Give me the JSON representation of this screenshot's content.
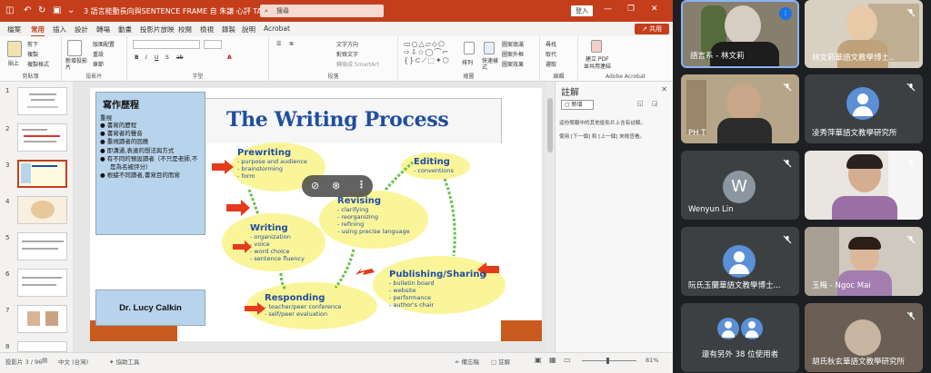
{
  "ppt": {
    "title": "3 語言能動長向與SENTENCE FRAME 自 朱謙 心評 TAWL  -  PowerPoint",
    "search_placeholder": "搜尋",
    "signin": "登入",
    "share": "共用",
    "tabs": [
      "檔案",
      "常用",
      "插入",
      "設計",
      "轉場",
      "動畫",
      "投影片放映",
      "校閱",
      "檢視",
      "錄製",
      "說明",
      "Acrobat"
    ],
    "active_tab": "常用",
    "ribbon": {
      "groups": [
        "剪貼簿",
        "投影片",
        "字型",
        "段落",
        "繪圖",
        "編輯",
        "Adobe Acrobat"
      ],
      "paste": "貼上",
      "cut": "剪下",
      "copy": "複製",
      "format_painter": "複製格式",
      "new_slide": "新增投影片",
      "layout": "版面配置",
      "reset": "重設",
      "section": "章節",
      "arrange": "排列",
      "quick_styles": "快速樣式",
      "shape_fill": "圖案填滿",
      "shape_outline": "圖案外框",
      "shape_effects": "圖案效果",
      "find": "尋找",
      "replace": "取代",
      "select": "選取",
      "create_pdf": "建立 PDF",
      "share_link": "並共用連結",
      "text_direction": "文字方向",
      "align_text": "對齊文字",
      "smartart": "轉換成 SmartArt"
    },
    "slide_numbers": [
      "1",
      "2",
      "3",
      "4",
      "5",
      "6",
      "7",
      "8"
    ],
    "slide": {
      "box_title": "寫作歷程",
      "box_subtitle": "重視",
      "bullets": [
        "書寫的歷程",
        "書寫者的聲音",
        "重視讀者的回應",
        "即溝通,表達的想法與方式",
        "有不同的預設讀者（不只是老師,不是為名被評分）",
        "根據不同讀者,書寫目的而寫"
      ],
      "author": "Dr. Lucy Calkin",
      "heading": "The Writing Process",
      "stages": {
        "prewriting": {
          "title": "Prewriting",
          "items": [
            "- purpose and audience",
            "- brainstorming",
            "- form"
          ]
        },
        "editing": {
          "title": "Editing",
          "items": [
            "- conventions"
          ]
        },
        "revising": {
          "title": "Revising",
          "items": [
            "- clarifying",
            "- reorganizing",
            "- refining",
            "- using precise language"
          ]
        },
        "writing": {
          "title": "Writing",
          "items": [
            "- organization",
            "- voice",
            "- word choice",
            "- sentence fluency"
          ]
        },
        "publishing": {
          "title": "Publishing/Sharing",
          "items": [
            "- bulletin board",
            "- website",
            "- performance",
            "- author's chair"
          ]
        },
        "responding": {
          "title": "Responding",
          "items": [
            "- teacher/peer conference",
            "- self/peer evaluation"
          ]
        }
      }
    },
    "comments": {
      "title": "註解",
      "new": "新增",
      "line1": "這份簡報中的其他投影片上含有註解。",
      "line2": "使用 [下一個] 和 [上一個] 來檢查看。"
    },
    "status": {
      "slide_of": "投影片 3 / 96",
      "lang": "中文 (台灣)",
      "access": "協助工具",
      "notes": "備忘稿",
      "comments": "註解",
      "zoom": "81%"
    }
  },
  "participants": [
    {
      "name": "語言系 - 林文莉",
      "mic": "on"
    },
    {
      "name": "林文莉華語文教學博士..",
      "mic": "muted"
    },
    {
      "name": "PH T",
      "mic": "muted"
    },
    {
      "name": "凌秀萍華語文教學研究所",
      "mic": "muted",
      "initial": ""
    },
    {
      "name": "Wenyun Lin",
      "mic": "muted",
      "initial": "W"
    },
    {
      "name": "",
      "mic": "muted"
    },
    {
      "name": "阮氏玉蘭華語文教學博士...",
      "mic": "muted"
    },
    {
      "name": "玉梅 - Ngoc Mai",
      "mic": "muted"
    },
    {
      "name": "還有另外 38 位使用者",
      "mic": "none"
    },
    {
      "name": "胡氏秋玄華語文教學研究所",
      "mic": "muted"
    }
  ],
  "colors": {
    "ppt_red": "#c43e1c",
    "tile": "#3c4043",
    "avatar_blue": "#5b8fd6",
    "heading_blue": "#1f4e9e",
    "stage_green": "#1f7f3a",
    "arrow_red": "#e53a1b",
    "ellipse_yellow": "#fbf59a"
  }
}
